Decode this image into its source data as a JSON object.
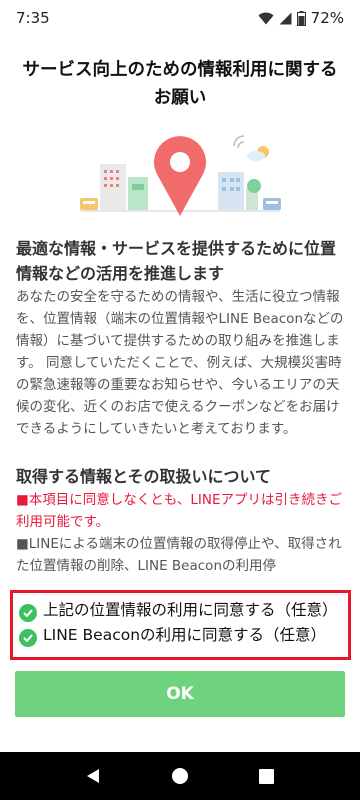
{
  "status_bar": {
    "time": "7:35",
    "battery": "72%",
    "icons": [
      "wifi-icon",
      "signal-icon",
      "battery-icon"
    ]
  },
  "title": "サービス向上のための情報利用に関するお願い",
  "content": {
    "section1_heading": "最適な情報・サービスを提供するために位置情報などの活用を推進します",
    "section1_body": "あなたの安全を守るための情報や、生活に役立つ情報を、位置情報（端末の位置情報やLINE Beaconなどの情報）に基づいて提供するための取り組みを推進します。 同意していただくことで、例えば、大規模災害時の緊急速報等の重要なお知らせや、今いるエリアの天候の変化、近くのお店で使えるクーポンなどをお届けできるようにしていきたいと考えております。",
    "section2_heading": "取得する情報とその取扱いについて",
    "section2_red": "■本項目に同意しなくとも、LINEアプリは引き続きご利用可能です。",
    "section2_body": "■LINEによる端末の位置情報の取得停止や、取得された位置情報の削除、LINE Beaconの利用停"
  },
  "consent": {
    "item1": "上記の位置情報の利用に同意する（任意）",
    "item2": "LINE Beaconの利用に同意する（任意）"
  },
  "buttons": {
    "ok": "OK"
  },
  "colors": {
    "accent_green": "#3cc060",
    "ok_button": "#6ed27f",
    "highlight_border": "#e6192c",
    "notice_red": "#e8193c",
    "pin": "#f26b6b"
  }
}
